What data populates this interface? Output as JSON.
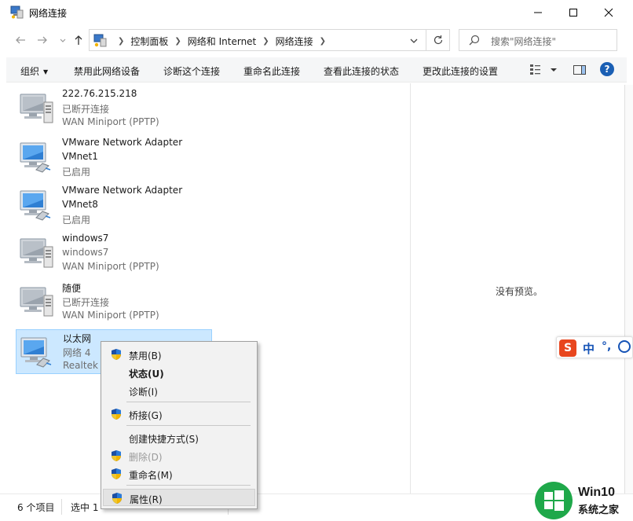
{
  "window": {
    "title": "网络连接",
    "minimize_icon": "minimize-icon",
    "maximize_icon": "maximize-icon",
    "close_icon": "close-icon"
  },
  "nav": {
    "breadcrumbs": [
      "控制面板",
      "网络和 Internet",
      "网络连接"
    ],
    "search_placeholder": "搜索\"网络连接\""
  },
  "commands": {
    "organize": "组织",
    "disable": "禁用此网络设备",
    "diagnose": "诊断这个连接",
    "rename": "重命名此连接",
    "view_status": "查看此连接的状态",
    "change_settings": "更改此连接的设置",
    "help": "?"
  },
  "connections": [
    {
      "name": "222.76.215.218",
      "line2": "已断开连接",
      "line3": "WAN Miniport (PPTP)",
      "icon": "wan-disconnected-icon"
    },
    {
      "name": "VMware Network Adapter",
      "line2": "VMnet1",
      "line3": "已启用",
      "icon": "ethernet-adapter-icon"
    },
    {
      "name": "VMware Network Adapter",
      "line2": "VMnet8",
      "line3": "已启用",
      "icon": "ethernet-adapter-icon"
    },
    {
      "name": "windows7",
      "line2": "windows7",
      "line3": "WAN Miniport (PPTP)",
      "icon": "wan-disconnected-icon"
    },
    {
      "name": "随便",
      "line2": "已断开连接",
      "line3": "WAN Miniport (PPTP)",
      "icon": "wan-disconnected-icon"
    },
    {
      "name": "以太网",
      "line2": "网络 4",
      "line3": "Realtek",
      "icon": "ethernet-adapter-icon"
    }
  ],
  "preview": {
    "empty_text": "没有预览。"
  },
  "status": {
    "count": "6 个项目",
    "selected": "选中 1"
  },
  "context_menu": [
    {
      "label": "禁用(B)",
      "shield": true,
      "bold": false,
      "disabled": false
    },
    {
      "label": "状态(U)",
      "shield": false,
      "bold": true,
      "disabled": false
    },
    {
      "label": "诊断(I)",
      "shield": false,
      "bold": false,
      "disabled": false
    },
    {
      "label": "桥接(G)",
      "shield": true,
      "bold": false,
      "disabled": false
    },
    {
      "label": "创建快捷方式(S)",
      "shield": false,
      "bold": false,
      "disabled": false
    },
    {
      "label": "删除(D)",
      "shield": true,
      "bold": false,
      "disabled": true
    },
    {
      "label": "重命名(M)",
      "shield": true,
      "bold": false,
      "disabled": false
    },
    {
      "label": "属性(R)",
      "shield": true,
      "bold": false,
      "disabled": false
    }
  ],
  "ime": {
    "logo": "S",
    "mode": "中",
    "punct": "°,",
    "emoji_icon": "smiley-icon"
  },
  "watermark": {
    "title": "Win10",
    "subtitle": "系统之家",
    "logo_icon": "windows-logo-icon"
  },
  "colors": {
    "selection_bg": "#cce8ff",
    "selection_border": "#99d1ff",
    "accent": "#1a5fb4"
  }
}
